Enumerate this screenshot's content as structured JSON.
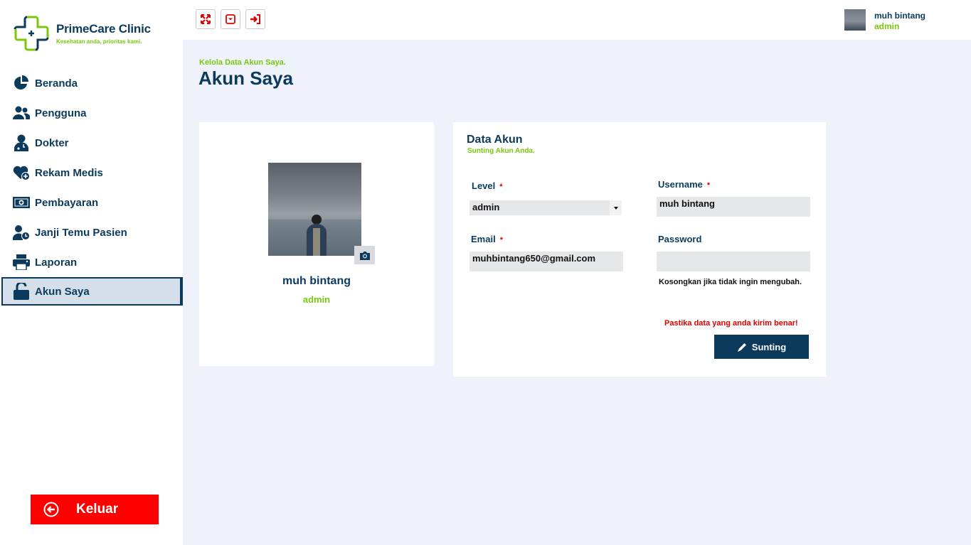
{
  "brand": {
    "name": "PrimeCare Clinic",
    "tagline": "Kesehatan anda, prioritas kami.",
    "accent": "#7ac70c",
    "primary": "#0b3a5c"
  },
  "sidebar": {
    "items": [
      {
        "label": "Beranda",
        "icon": "pie-chart-icon"
      },
      {
        "label": "Pengguna",
        "icon": "users-icon"
      },
      {
        "label": "Dokter",
        "icon": "doctor-icon"
      },
      {
        "label": "Rekam Medis",
        "icon": "heart-plus-icon"
      },
      {
        "label": "Pembayaran",
        "icon": "money-icon"
      },
      {
        "label": "Janji Temu Pasien",
        "icon": "user-clock-icon"
      },
      {
        "label": "Laporan",
        "icon": "printer-icon"
      },
      {
        "label": "Akun Saya",
        "icon": "unlock-icon",
        "active": true
      }
    ],
    "logout_label": "Keluar",
    "logout_color": "#ff0000"
  },
  "topbar": {
    "buttons": [
      "fullscreen-icon",
      "collapse-icon",
      "sign-in-icon"
    ],
    "user_name": "muh bintang",
    "user_role": "admin"
  },
  "page": {
    "subtitle": "Kelola Data Akun Saya.",
    "title": "Akun Saya"
  },
  "profile": {
    "name": "muh bintang",
    "role": "admin"
  },
  "form": {
    "title": "Data Akun",
    "subtitle": "Sunting Akun Anda.",
    "level_label": "Level",
    "level_value": "admin",
    "username_label": "Username",
    "username_value": "muh bintang",
    "email_label": "Email",
    "email_value": "muhbintang650@gmail.com",
    "password_label": "Password",
    "password_value": "",
    "password_hint": "Kosongkan jika tidak ingin mengubah.",
    "required_mark": "*",
    "warning": "Pastika data yang anda kirim benar!",
    "submit_label": "Sunting"
  }
}
